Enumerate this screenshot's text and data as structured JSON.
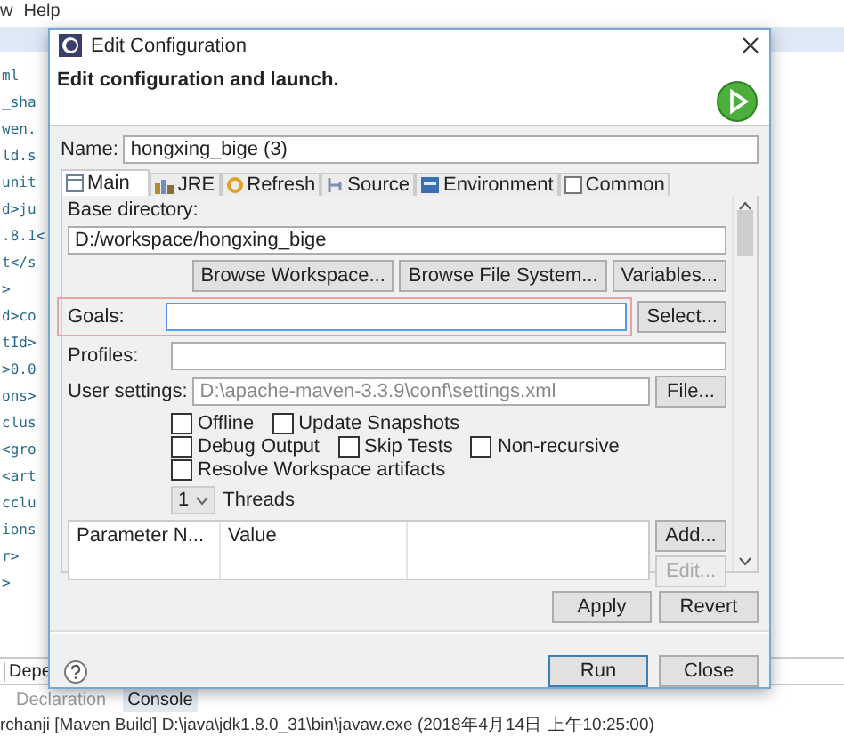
{
  "background": {
    "menu": [
      "w",
      "Help"
    ],
    "code_lines": [
      "ml",
      "_sha",
      "wen.",
      "ld.s",
      "unit",
      "d>ju",
      ".8.1<",
      "t</s",
      ">",
      "d>co",
      "tId>",
      ">0.0",
      "ons>",
      "clus",
      "<gro",
      "<art",
      "cclu",
      "ions",
      "r>",
      ">"
    ],
    "view_tab": "Depe",
    "console_tabs": [
      {
        "label": "Declaration",
        "selected": false
      },
      {
        "label": "Console",
        "selected": true
      }
    ],
    "console_text": "rchanji [Maven Build] D:\\java\\jdk1.8.0_31\\bin\\javaw.exe (2018年4月14日 上午10:25:00)"
  },
  "dialog": {
    "title": "Edit Configuration",
    "heading": "Edit configuration and launch.",
    "name_label": "Name:",
    "name_value": "hongxing_bige (3)",
    "tabs": [
      {
        "label": "Main",
        "selected": true
      },
      {
        "label": "JRE",
        "selected": false
      },
      {
        "label": "Refresh",
        "selected": false
      },
      {
        "label": "Source",
        "selected": false
      },
      {
        "label": "Environment",
        "selected": false
      },
      {
        "label": "Common",
        "selected": false
      }
    ],
    "base_dir_label": "Base directory:",
    "base_dir_value": "D:/workspace/hongxing_bige",
    "browse_buttons": [
      "Browse Workspace...",
      "Browse File System...",
      "Variables..."
    ],
    "goals": {
      "label": "Goals:",
      "button": "Select...",
      "highlighted": true,
      "focused": true
    },
    "profiles_label": "Profiles:",
    "user_settings": {
      "label": "User settings:",
      "value": "D:\\apache-maven-3.3.9\\conf\\settings.xml",
      "button": "File..."
    },
    "options": [
      [
        {
          "label": "Offline",
          "checked": false
        },
        {
          "label": "Update Snapshots",
          "checked": false
        }
      ],
      [
        {
          "label": "Debug Output",
          "checked": false
        },
        {
          "label": "Skip Tests",
          "checked": false
        },
        {
          "label": "Non-recursive",
          "checked": false
        }
      ],
      [
        {
          "label": "Resolve Workspace artifacts",
          "checked": false
        }
      ]
    ],
    "threads": {
      "value": "1",
      "label": "Threads"
    },
    "param_columns": [
      "Parameter N...",
      "Value"
    ],
    "param_buttons": [
      {
        "label": "Add...",
        "disabled": false
      },
      {
        "label": "Edit...",
        "disabled": true
      }
    ],
    "apply_buttons": [
      "Apply",
      "Revert"
    ],
    "footer_buttons": [
      {
        "label": "Run",
        "default": true
      },
      {
        "label": "Close",
        "default": false
      }
    ]
  }
}
